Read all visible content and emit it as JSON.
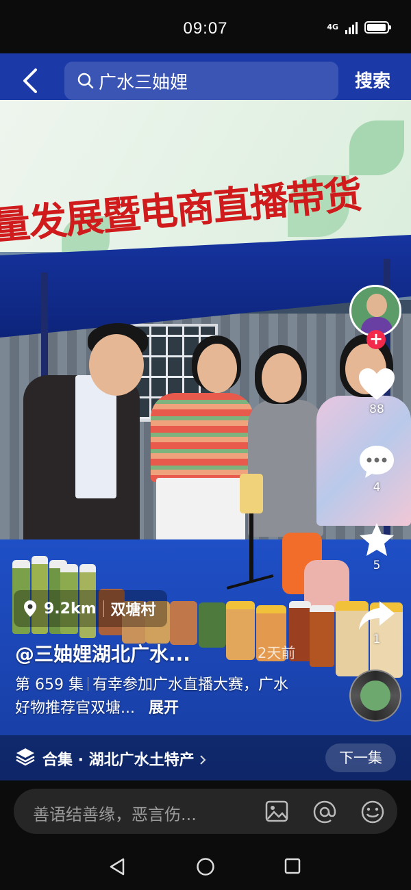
{
  "status_bar": {
    "time": "09:07",
    "network": "4G",
    "battery_level": 0.95
  },
  "search": {
    "query": "广水三妯娌",
    "button_label": "搜索"
  },
  "video": {
    "banner_text": "量发展暨电商直播带货"
  },
  "actions": {
    "likes": "88",
    "comments": "4",
    "favorites": "5",
    "shares": "1"
  },
  "location": {
    "distance": "9.2km",
    "place": "双塘村"
  },
  "post": {
    "author": "@三妯娌湖北广水...",
    "time_ago": "2天前",
    "episode": "第 659 集",
    "description": "有幸参加广水直播大赛，广水好物推荐官双塘...",
    "expand_label": "展开"
  },
  "collection": {
    "label": "合集 · 湖北广水土特产",
    "next_label": "下一集"
  },
  "comment": {
    "placeholder": "善语结善缘，恶言伤..."
  }
}
